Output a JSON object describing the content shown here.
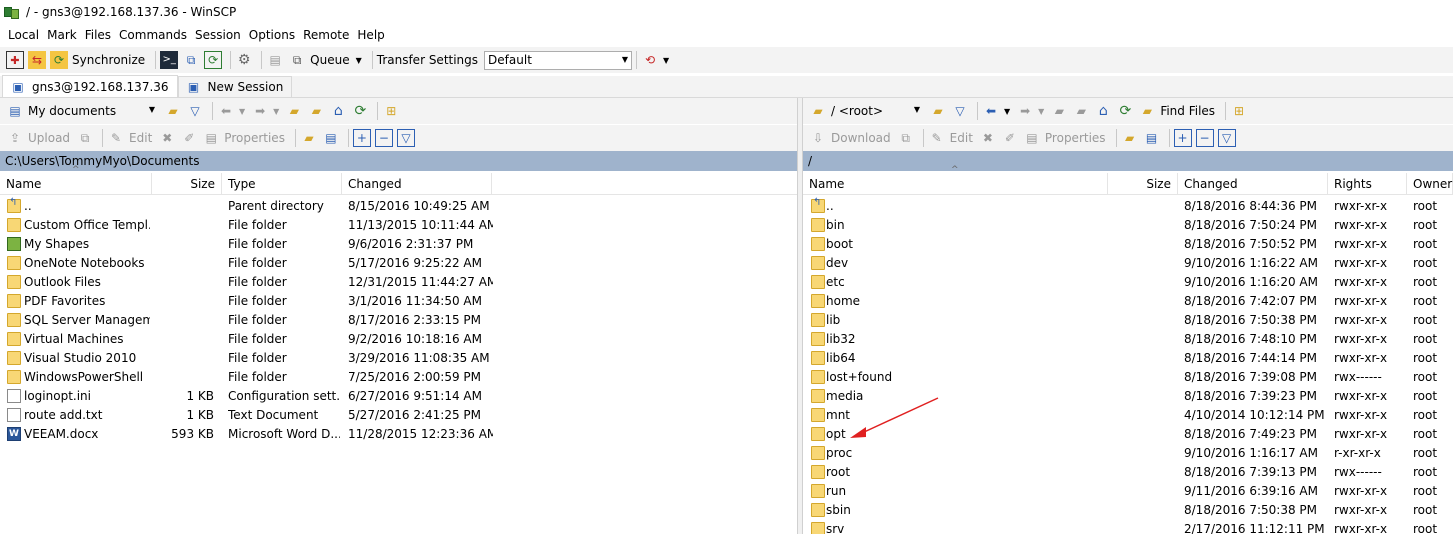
{
  "window": {
    "title": "/ - gns3@192.168.137.36 - WinSCP"
  },
  "menu": [
    "Local",
    "Mark",
    "Files",
    "Commands",
    "Session",
    "Options",
    "Remote",
    "Help"
  ],
  "toolbar": {
    "synchronize": "Synchronize",
    "queue": "Queue",
    "transfer_settings": "Transfer Settings",
    "transfer_value": "Default"
  },
  "tabs": [
    {
      "label": "gns3@192.168.137.36",
      "active": true
    },
    {
      "label": "New Session",
      "active": false
    }
  ],
  "left": {
    "location": "My documents",
    "actions": {
      "upload": "Upload",
      "edit": "Edit",
      "properties": "Properties"
    },
    "path": "C:\\Users\\TommyMyo\\Documents",
    "columns": [
      "Name",
      "Size",
      "Type",
      "Changed"
    ],
    "rows": [
      {
        "name": "..",
        "size": "",
        "type": "Parent directory",
        "changed": "8/15/2016  10:49:25 AM",
        "icon": "parent-folder-icon"
      },
      {
        "name": "Custom Office Templ...",
        "size": "",
        "type": "File folder",
        "changed": "11/13/2015  10:11:44 AM",
        "icon": "folder-icon"
      },
      {
        "name": "My Shapes",
        "size": "",
        "type": "File folder",
        "changed": "9/6/2016  2:31:37 PM",
        "icon": "shapes-folder-icon"
      },
      {
        "name": "OneNote Notebooks",
        "size": "",
        "type": "File folder",
        "changed": "5/17/2016  9:25:22 AM",
        "icon": "folder-icon"
      },
      {
        "name": "Outlook Files",
        "size": "",
        "type": "File folder",
        "changed": "12/31/2015  11:44:27 AM",
        "icon": "folder-icon"
      },
      {
        "name": "PDF Favorites",
        "size": "",
        "type": "File folder",
        "changed": "3/1/2016  11:34:50 AM",
        "icon": "folder-icon"
      },
      {
        "name": "SQL Server Managem...",
        "size": "",
        "type": "File folder",
        "changed": "8/17/2016  2:33:15 PM",
        "icon": "folder-icon"
      },
      {
        "name": "Virtual Machines",
        "size": "",
        "type": "File folder",
        "changed": "9/2/2016  10:18:16 AM",
        "icon": "folder-icon"
      },
      {
        "name": "Visual Studio 2010",
        "size": "",
        "type": "File folder",
        "changed": "3/29/2016  11:08:35 AM",
        "icon": "folder-icon"
      },
      {
        "name": "WindowsPowerShell",
        "size": "",
        "type": "File folder",
        "changed": "7/25/2016  2:00:59 PM",
        "icon": "folder-icon"
      },
      {
        "name": "loginopt.ini",
        "size": "1 KB",
        "type": "Configuration sett...",
        "changed": "6/27/2016  9:51:14 AM",
        "icon": "ini-file-icon"
      },
      {
        "name": "route add.txt",
        "size": "1 KB",
        "type": "Text Document",
        "changed": "5/27/2016  2:41:25 PM",
        "icon": "text-file-icon"
      },
      {
        "name": "VEEAM.docx",
        "size": "593 KB",
        "type": "Microsoft Word D...",
        "changed": "11/28/2015  12:23:36 AM",
        "icon": "word-file-icon"
      }
    ]
  },
  "right": {
    "location": "/ <root>",
    "find_files": "Find Files",
    "actions": {
      "download": "Download",
      "edit": "Edit",
      "properties": "Properties"
    },
    "path": "/",
    "columns": [
      "Name",
      "Size",
      "Changed",
      "Rights",
      "Owner"
    ],
    "rows": [
      {
        "name": "..",
        "changed": "8/18/2016 8:44:36 PM",
        "rights": "rwxr-xr-x",
        "owner": "root",
        "icon": "parent-folder-icon"
      },
      {
        "name": "bin",
        "changed": "8/18/2016 7:50:24 PM",
        "rights": "rwxr-xr-x",
        "owner": "root",
        "icon": "folder-icon"
      },
      {
        "name": "boot",
        "changed": "8/18/2016 7:50:52 PM",
        "rights": "rwxr-xr-x",
        "owner": "root",
        "icon": "folder-icon"
      },
      {
        "name": "dev",
        "changed": "9/10/2016 1:16:22 AM",
        "rights": "rwxr-xr-x",
        "owner": "root",
        "icon": "folder-icon"
      },
      {
        "name": "etc",
        "changed": "9/10/2016 1:16:20 AM",
        "rights": "rwxr-xr-x",
        "owner": "root",
        "icon": "folder-icon"
      },
      {
        "name": "home",
        "changed": "8/18/2016 7:42:07 PM",
        "rights": "rwxr-xr-x",
        "owner": "root",
        "icon": "folder-icon"
      },
      {
        "name": "lib",
        "changed": "8/18/2016 7:50:38 PM",
        "rights": "rwxr-xr-x",
        "owner": "root",
        "icon": "folder-icon"
      },
      {
        "name": "lib32",
        "changed": "8/18/2016 7:48:10 PM",
        "rights": "rwxr-xr-x",
        "owner": "root",
        "icon": "folder-icon"
      },
      {
        "name": "lib64",
        "changed": "8/18/2016 7:44:14 PM",
        "rights": "rwxr-xr-x",
        "owner": "root",
        "icon": "folder-icon"
      },
      {
        "name": "lost+found",
        "changed": "8/18/2016 7:39:08 PM",
        "rights": "rwx------",
        "owner": "root",
        "icon": "folder-icon"
      },
      {
        "name": "media",
        "changed": "8/18/2016 7:39:23 PM",
        "rights": "rwxr-xr-x",
        "owner": "root",
        "icon": "folder-icon"
      },
      {
        "name": "mnt",
        "changed": "4/10/2014 10:12:14 PM",
        "rights": "rwxr-xr-x",
        "owner": "root",
        "icon": "folder-icon"
      },
      {
        "name": "opt",
        "changed": "8/18/2016 7:49:23 PM",
        "rights": "rwxr-xr-x",
        "owner": "root",
        "icon": "folder-icon"
      },
      {
        "name": "proc",
        "changed": "9/10/2016 1:16:17 AM",
        "rights": "r-xr-xr-x",
        "owner": "root",
        "icon": "folder-icon"
      },
      {
        "name": "root",
        "changed": "8/18/2016 7:39:13 PM",
        "rights": "rwx------",
        "owner": "root",
        "icon": "folder-icon"
      },
      {
        "name": "run",
        "changed": "9/11/2016 6:39:16 AM",
        "rights": "rwxr-xr-x",
        "owner": "root",
        "icon": "folder-icon"
      },
      {
        "name": "sbin",
        "changed": "8/18/2016 7:50:38 PM",
        "rights": "rwxr-xr-x",
        "owner": "root",
        "icon": "folder-icon"
      },
      {
        "name": "srv",
        "changed": "2/17/2016 11:12:11 PM",
        "rights": "rwxr-xr-x",
        "owner": "root",
        "icon": "folder-icon"
      }
    ]
  },
  "annotation": {
    "color": "#e02020",
    "target": "opt"
  }
}
